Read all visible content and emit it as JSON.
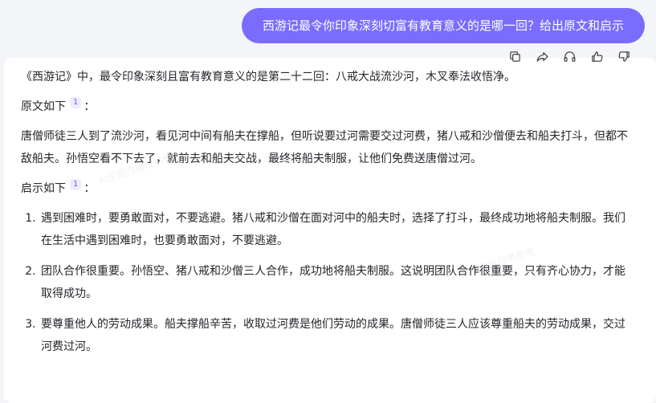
{
  "user_message": "西游记最令你印象深刻切富有教育意义的是哪一回？给出原文和启示",
  "toolbar": {
    "copy_icon": "copy-icon",
    "share_icon": "share-icon",
    "listen_icon": "headphones-icon",
    "like_icon": "thumbs-up-icon",
    "dislike_icon": "thumbs-down-icon"
  },
  "answer": {
    "intro": "《西游记》中，最令印象深刻且富有教育意义的是第二十二回：八戒大战流沙河，木叉奉法收悟净。",
    "original_label": "原文如下",
    "original_cite": "1",
    "original_colon": "：",
    "original_text": "唐僧师徒三人到了流沙河，看见河中间有船夫在撑船，但听说要过河需要交过河费，猪八戒和沙僧便去和船夫打斗，但都不敌船夫。孙悟空看不下去了，就前去和船夫交战，最终将船夫制服，让他们免费送唐僧过河。",
    "insight_label": "启示如下",
    "insight_cite": "1",
    "insight_colon": "：",
    "insights": [
      "遇到困难时，要勇敢面对，不要逃避。猪八戒和沙僧在面对河中的船夫时，选择了打斗，最终成功地将船夫制服。我们在生活中遇到困难时，也要勇敢面对，不要逃避。",
      "团队合作很重要。孙悟空、猪八戒和沙僧三人合作，成功地将船夫制服。这说明团队合作很重要，只有齐心协力，才能取得成功。",
      "要尊重他人的劳动成果。船夫撑船辛苦，收取过河费是他们劳动的成果。唐僧师徒三人应该尊重船夫的劳动成果，交过河费过河。"
    ]
  },
  "watermark_text": "AI生成内容仅供参考"
}
